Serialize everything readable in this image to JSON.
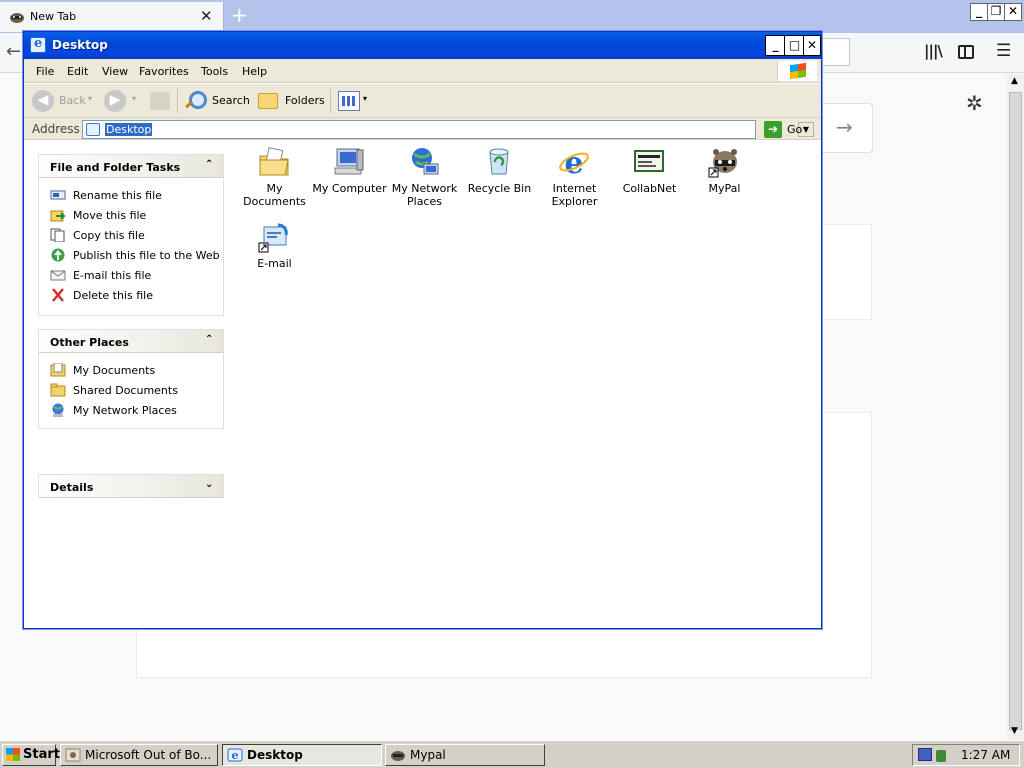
{
  "browser": {
    "tab_title": "New Tab",
    "tab_close": "✕",
    "new_tab": "+",
    "win_minimize": "_",
    "win_restore": "❐",
    "win_close": "✕",
    "back_glyph": "←",
    "library_glyph": "|||\\",
    "menu_glyph": "☰",
    "gear_glyph": "✲",
    "go_arrow_glyph": "→"
  },
  "explorer": {
    "title": "Desktop",
    "caption": {
      "minimize": "_",
      "maximize": "□",
      "close": "✕"
    },
    "menu": [
      "File",
      "Edit",
      "View",
      "Favorites",
      "Tools",
      "Help"
    ],
    "toolbar": {
      "back_label": "Back",
      "back_glyph": "◀",
      "forward_glyph": "▶",
      "dropdown_glyph": "▾",
      "search_label": "Search",
      "folders_label": "Folders"
    },
    "address": {
      "label": "Address",
      "value": "Desktop",
      "dropdown_glyph": "▼",
      "go_glyph": "➔",
      "go_label": "Go"
    },
    "task_panes": [
      {
        "title": "File and Folder Tasks",
        "chevron": "⌃",
        "items": [
          {
            "label": "Rename this file",
            "icon": "rename-icon"
          },
          {
            "label": "Move this file",
            "icon": "move-icon"
          },
          {
            "label": "Copy this file",
            "icon": "copy-icon"
          },
          {
            "label": "Publish this file to the Web",
            "icon": "publish-web-icon"
          },
          {
            "label": "E-mail this file",
            "icon": "email-icon"
          },
          {
            "label": "Delete this file",
            "icon": "delete-icon"
          }
        ]
      },
      {
        "title": "Other Places",
        "chevron": "⌃",
        "items": [
          {
            "label": "My Documents",
            "icon": "my-documents-icon"
          },
          {
            "label": "Shared Documents",
            "icon": "shared-folder-icon"
          },
          {
            "label": "My Network Places",
            "icon": "network-places-icon"
          }
        ]
      },
      {
        "title": "Details",
        "chevron": "⌄",
        "items": []
      }
    ],
    "desktop_icons": [
      {
        "label": "My Documents",
        "icon": "my-documents-folder-icon"
      },
      {
        "label": "My Computer",
        "icon": "my-computer-icon"
      },
      {
        "label": "My Network Places",
        "icon": "network-globe-icon"
      },
      {
        "label": "Recycle Bin",
        "icon": "recycle-bin-icon"
      },
      {
        "label": "Internet Explorer",
        "icon": "internet-explorer-icon"
      },
      {
        "label": "CollabNet",
        "icon": "collabnet-icon"
      },
      {
        "label": "MyPal",
        "icon": "mypal-raccoon-icon"
      },
      {
        "label": "E-mail",
        "icon": "email-shortcut-icon"
      }
    ]
  },
  "taskbar": {
    "start_label": "Start",
    "buttons": [
      {
        "label": "Microsoft Out of Bo...",
        "icon": "oobe-icon",
        "active": false
      },
      {
        "label": "Desktop",
        "icon": "explorer-icon",
        "active": true
      },
      {
        "label": "Mypal",
        "icon": "mypal-icon",
        "active": false
      }
    ],
    "clock": "1:27 AM"
  },
  "colors": {
    "title_bar": "#0148d8",
    "chrome": "#ece9d8",
    "selection": "#316ac5",
    "browser_tabbar": "#b4c3ea"
  }
}
